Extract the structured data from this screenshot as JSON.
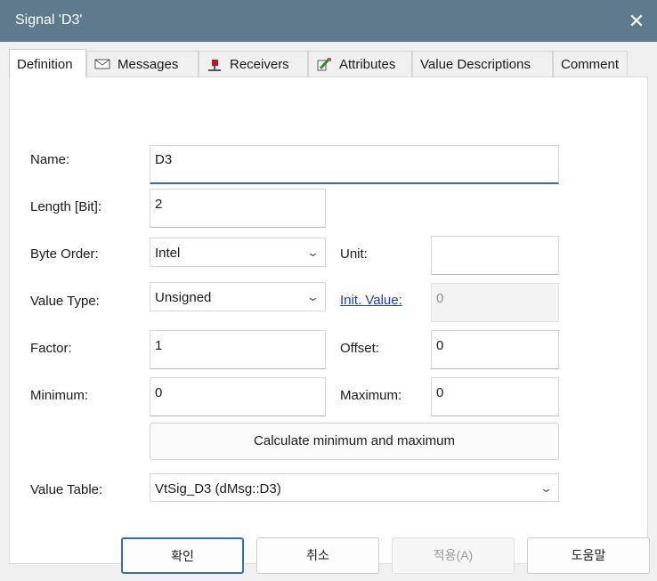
{
  "window": {
    "title": "Signal 'D3'",
    "close_symbol": "✕"
  },
  "tabs": [
    {
      "label": "Definition",
      "icon": ""
    },
    {
      "label": "Messages",
      "icon": "envelope-icon"
    },
    {
      "label": "Receivers",
      "icon": "receiver-icon"
    },
    {
      "label": "Attributes",
      "icon": "attributes-icon"
    },
    {
      "label": "Value Descriptions",
      "icon": ""
    },
    {
      "label": "Comment",
      "icon": ""
    }
  ],
  "form": {
    "name_label": "Name:",
    "name_value": "D3",
    "length_label": "Length [Bit]:",
    "length_value": "2",
    "byte_order_label": "Byte Order:",
    "byte_order_value": "Intel",
    "unit_label": "Unit:",
    "unit_value": "",
    "value_type_label": "Value Type:",
    "value_type_value": "Unsigned",
    "init_value_label": "Init. Value:",
    "init_value_value": "0",
    "factor_label": "Factor:",
    "factor_value": "1",
    "offset_label": "Offset:",
    "offset_value": "0",
    "minimum_label": "Minimum:",
    "minimum_value": "0",
    "maximum_label": "Maximum:",
    "maximum_value": "0",
    "calc_button_label": "Calculate minimum and maximum",
    "value_table_label": "Value Table:",
    "value_table_value": "VtSig_D3 (dMsg::D3)"
  },
  "footer": {
    "ok_label": "확인",
    "cancel_label": "취소",
    "apply_label": "적용(A)",
    "help_label": "도움말"
  },
  "colors": {
    "titlebar": "#5e7a8c",
    "link": "#1a37d6",
    "focus": "#2f6fb0"
  }
}
